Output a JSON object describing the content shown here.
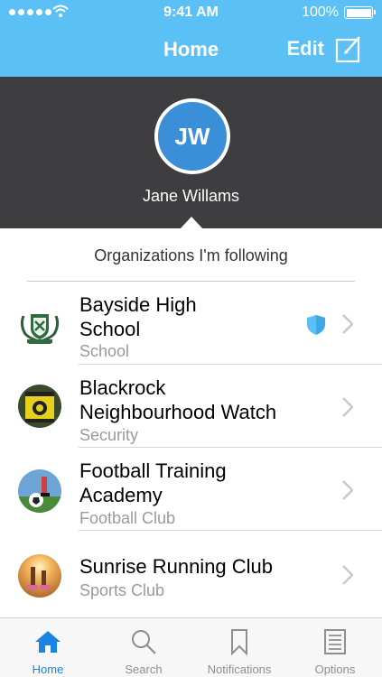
{
  "status_bar": {
    "time": "9:41 AM",
    "battery": "100%"
  },
  "nav": {
    "title": "Home",
    "edit_label": "Edit",
    "edit_icon": "compose-icon"
  },
  "profile": {
    "initials": "JW",
    "name": "Jane Willams"
  },
  "section": {
    "title": "Organizations I'm following"
  },
  "organizations": [
    {
      "name_line1": "Bayside High",
      "name_line2": "School",
      "type": "School",
      "verified": true
    },
    {
      "name_line1": "Blackrock",
      "name_line2": "Neighbourhood Watch",
      "type": "Security",
      "verified": false
    },
    {
      "name_line1": "Football Training",
      "name_line2": "Academy",
      "type": "Football Club",
      "verified": false
    },
    {
      "name_line1": "Sunrise Running Club",
      "name_line2": "",
      "type": "Sports Club",
      "verified": false
    }
  ],
  "tabs": [
    {
      "label": "Home",
      "icon": "home-icon",
      "active": true
    },
    {
      "label": "Search",
      "icon": "search-icon",
      "active": false
    },
    {
      "label": "Notifications",
      "icon": "bookmark-icon",
      "active": false
    },
    {
      "label": "Options",
      "icon": "list-icon",
      "active": false
    }
  ],
  "colors": {
    "nav_blue": "#5bc0f5",
    "header_dark": "#3e3e40",
    "avatar_blue": "#3b8fd8",
    "tab_active": "#1a84e0",
    "verified_blue": "#5bc0f5"
  }
}
